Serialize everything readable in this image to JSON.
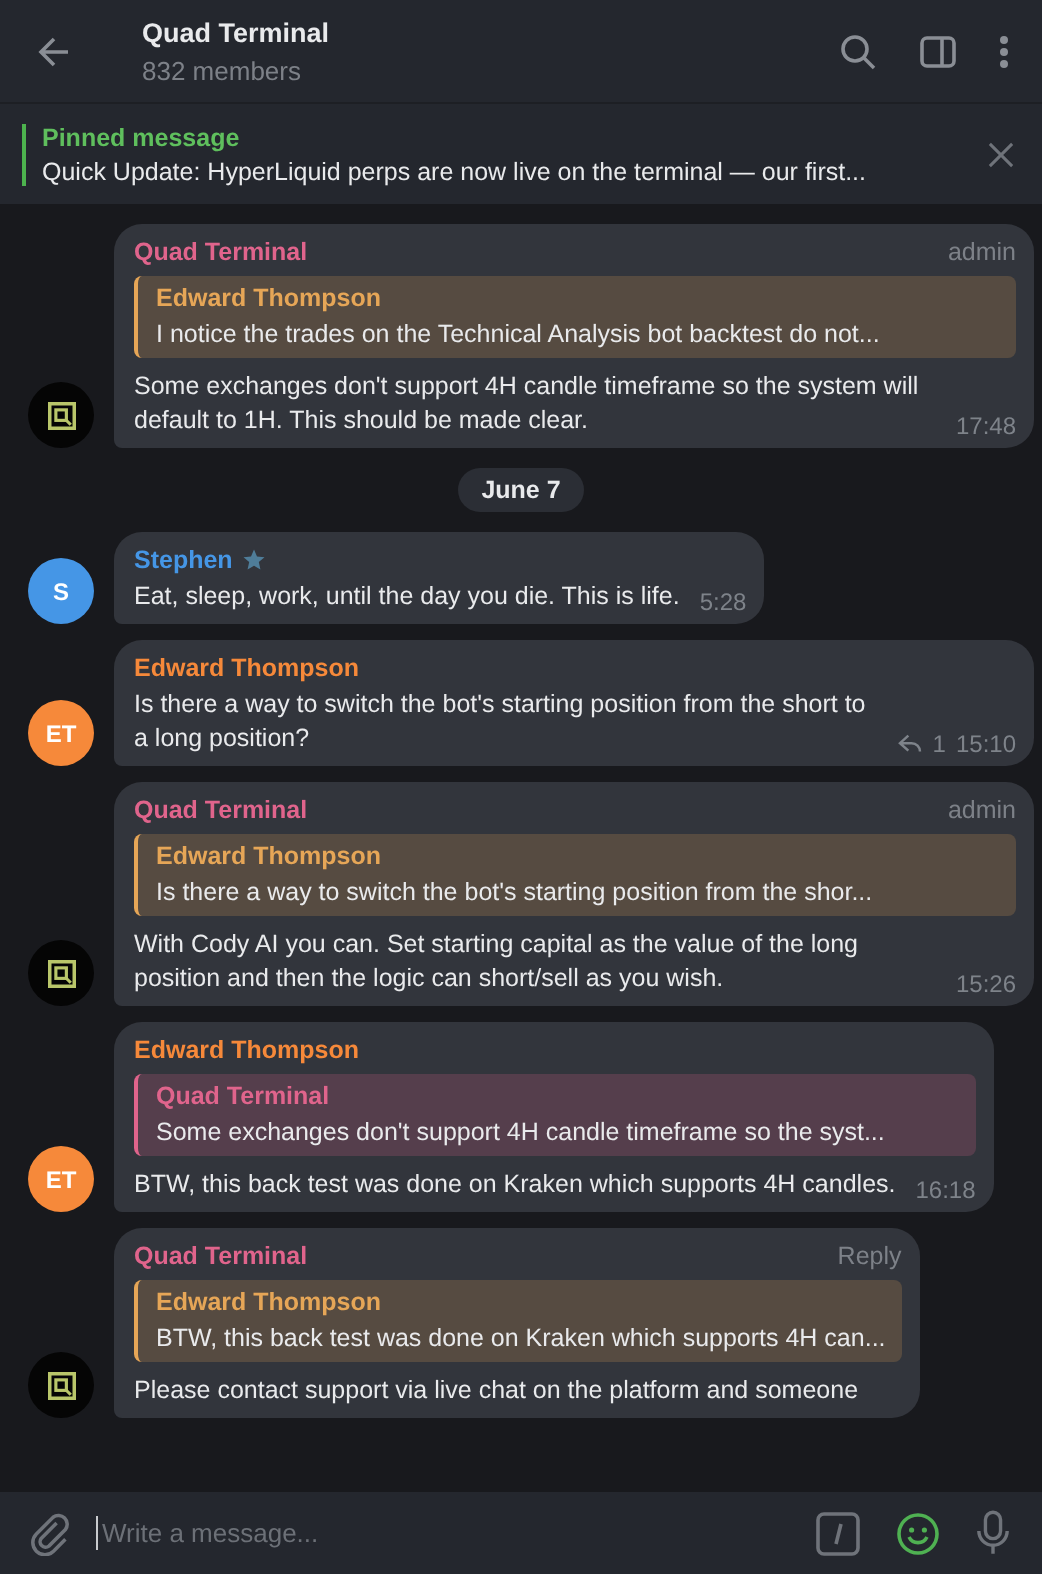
{
  "header": {
    "title": "Quad Terminal",
    "subtitle": "832 members"
  },
  "pinned": {
    "label": "Pinned message",
    "text": "Quick Update:  HyperLiquid perps are now live on the terminal — our first..."
  },
  "messages": [
    {
      "kind": "message",
      "sender": "Quad Terminal",
      "tag": "admin",
      "avatar": {
        "kind": "logo"
      },
      "reply": {
        "sender": "Edward Thompson",
        "color": "#e6a657",
        "text": "I notice the trades on the Technical Analysis bot backtest do not..."
      },
      "text": "Some exchanges don't support 4H candle timeframe so the system will default to 1H. This should be made clear.",
      "time": "17:48"
    },
    {
      "kind": "date",
      "text": "June 7"
    },
    {
      "kind": "message",
      "sender": "Stephen",
      "star": true,
      "avatar": {
        "kind": "initials",
        "text": "S",
        "color": "#4596e6"
      },
      "text": "Eat, sleep, work, until the day you die. This is life.",
      "time": "5:28"
    },
    {
      "kind": "message",
      "sender": "Edward Thompson",
      "avatar": {
        "kind": "initials",
        "text": "ET",
        "color": "#f6893a"
      },
      "replies": "1",
      "text": "Is there a way to switch the bot's starting position from the short to a long position?",
      "time": "15:10"
    },
    {
      "kind": "message",
      "sender": "Quad Terminal",
      "tag": "admin",
      "avatar": {
        "kind": "logo"
      },
      "reply": {
        "sender": "Edward Thompson",
        "color": "#e6a657",
        "text": "Is there a way to switch the bot's starting position from the shor..."
      },
      "text": "With Cody AI you can. Set starting capital as the value of the long position and then the logic can short/sell as you wish.",
      "time": "15:26"
    },
    {
      "kind": "message",
      "sender": "Edward Thompson",
      "avatar": {
        "kind": "initials",
        "text": "ET",
        "color": "#f6893a"
      },
      "reply": {
        "sender": "Quad Terminal",
        "color": "#e0648c",
        "text": "Some exchanges don't support 4H candle timeframe so the syst..."
      },
      "text": "BTW, this back test was done on Kraken which supports 4H candles.",
      "time": "16:18"
    },
    {
      "kind": "message",
      "sender": "Quad Terminal",
      "tag": "Reply",
      "avatar": {
        "kind": "logo"
      },
      "reply": {
        "sender": "Edward Thompson",
        "color": "#e6a657",
        "text": "BTW, this back test was done on Kraken which supports 4H can..."
      },
      "text": "Please contact support via live chat on the platform and someone"
    }
  ],
  "composer": {
    "placeholder": "Write a message..."
  }
}
